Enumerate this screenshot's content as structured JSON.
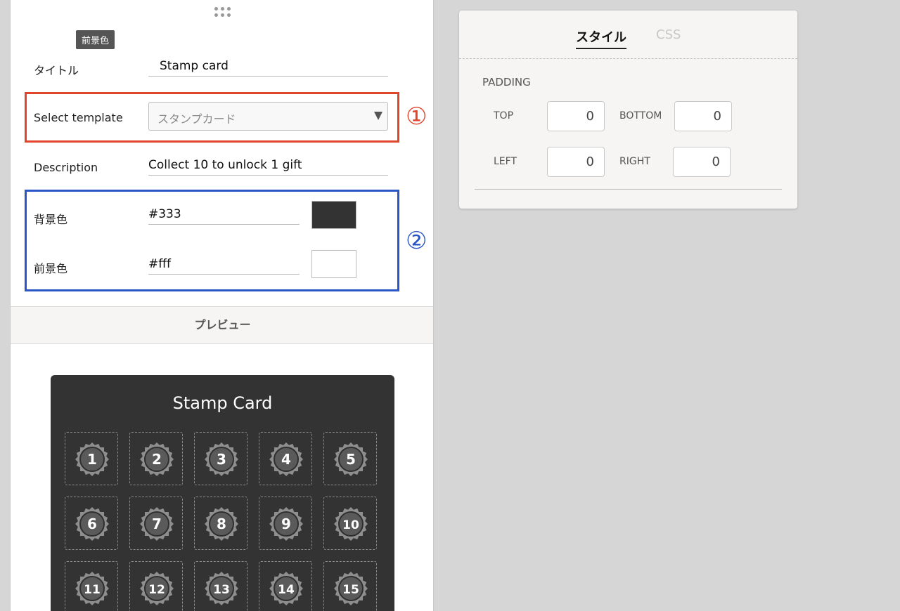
{
  "tooltip": "前景色",
  "form": {
    "title_label": "タイトル",
    "title_value": "Stamp card",
    "template_label": "Select template",
    "template_value": "スタンプカード",
    "description_label": "Description",
    "description_value": "Collect 10 to unlock 1 gift",
    "bg_label": "背景色",
    "bg_value": "#333",
    "fg_label": "前景色",
    "fg_value": "#fff"
  },
  "annotations": {
    "one": "①",
    "two": "②",
    "one_color": "#e0452b",
    "two_color": "#2a55c7"
  },
  "preview": {
    "header": "プレビュー",
    "card_title": "Stamp Card",
    "card_bg": "#333333",
    "stamps": [
      "1",
      "2",
      "3",
      "4",
      "5",
      "6",
      "7",
      "8",
      "9",
      "10",
      "11",
      "12",
      "13",
      "14",
      "15"
    ]
  },
  "style_panel": {
    "tab_style": "スタイル",
    "tab_css": "CSS",
    "section": "PADDING",
    "top_label": "TOP",
    "top_value": "0",
    "bottom_label": "BOTTOM",
    "bottom_value": "0",
    "left_label": "LEFT",
    "left_value": "0",
    "right_label": "RIGHT",
    "right_value": "0"
  }
}
